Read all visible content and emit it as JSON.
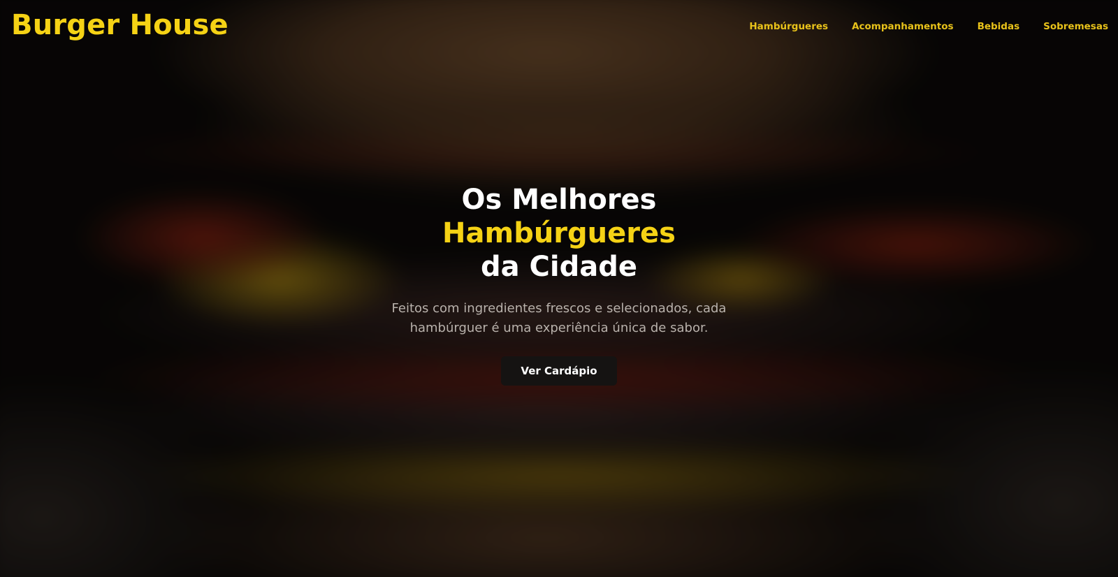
{
  "brand": {
    "name": "Burger House",
    "accent_color": "#f5d215"
  },
  "nav": {
    "items": [
      {
        "label": "Hambúrgueres"
      },
      {
        "label": "Acompanhamentos"
      },
      {
        "label": "Bebidas"
      },
      {
        "label": "Sobremesas"
      }
    ]
  },
  "hero": {
    "background_image": "blurred-burger-photo",
    "title_line1": "Os Melhores",
    "title_line2": "Hambúrgueres",
    "title_line3": "da Cidade",
    "subtitle": "Feitos com ingredientes frescos e selecionados, cada hambúrguer é uma experiência única de sabor.",
    "cta_label": "Ver Cardápio"
  }
}
